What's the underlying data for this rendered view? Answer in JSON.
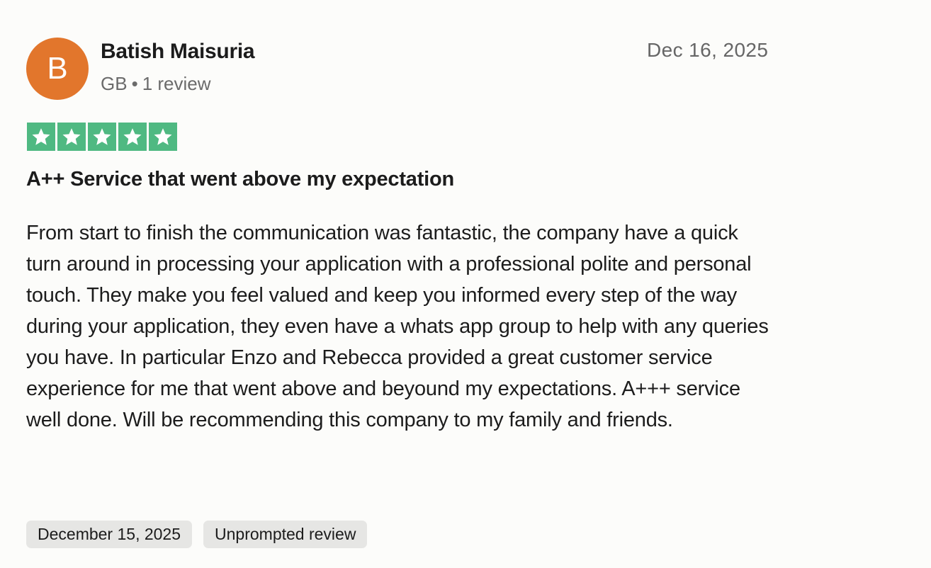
{
  "reviewer": {
    "initial": "B",
    "name": "Batish Maisuria",
    "country": "GB",
    "separator": "•",
    "review_count": "1 review",
    "avatar_color": "#e2762c"
  },
  "review": {
    "date": "Dec 16, 2025",
    "rating": 5,
    "rating_max": 5,
    "star_color": "#4fb982",
    "title": "A++ Service that went above my expectation",
    "body": "From start to finish the communication was fantastic, the company have a quick turn around in processing your application with a professional polite and personal touch. They make you feel valued and keep you informed every step of the way during your application, they even have a whats app group to help with any queries you have. In particular Enzo and Rebecca provided a great customer service experience for me that went above and beyound my expectations. A+++ service well done. Will be recommending this company to my family and friends.",
    "experience_date": "December 15, 2025",
    "review_type": "Unprompted review"
  },
  "icons": {
    "star": "star-icon"
  }
}
